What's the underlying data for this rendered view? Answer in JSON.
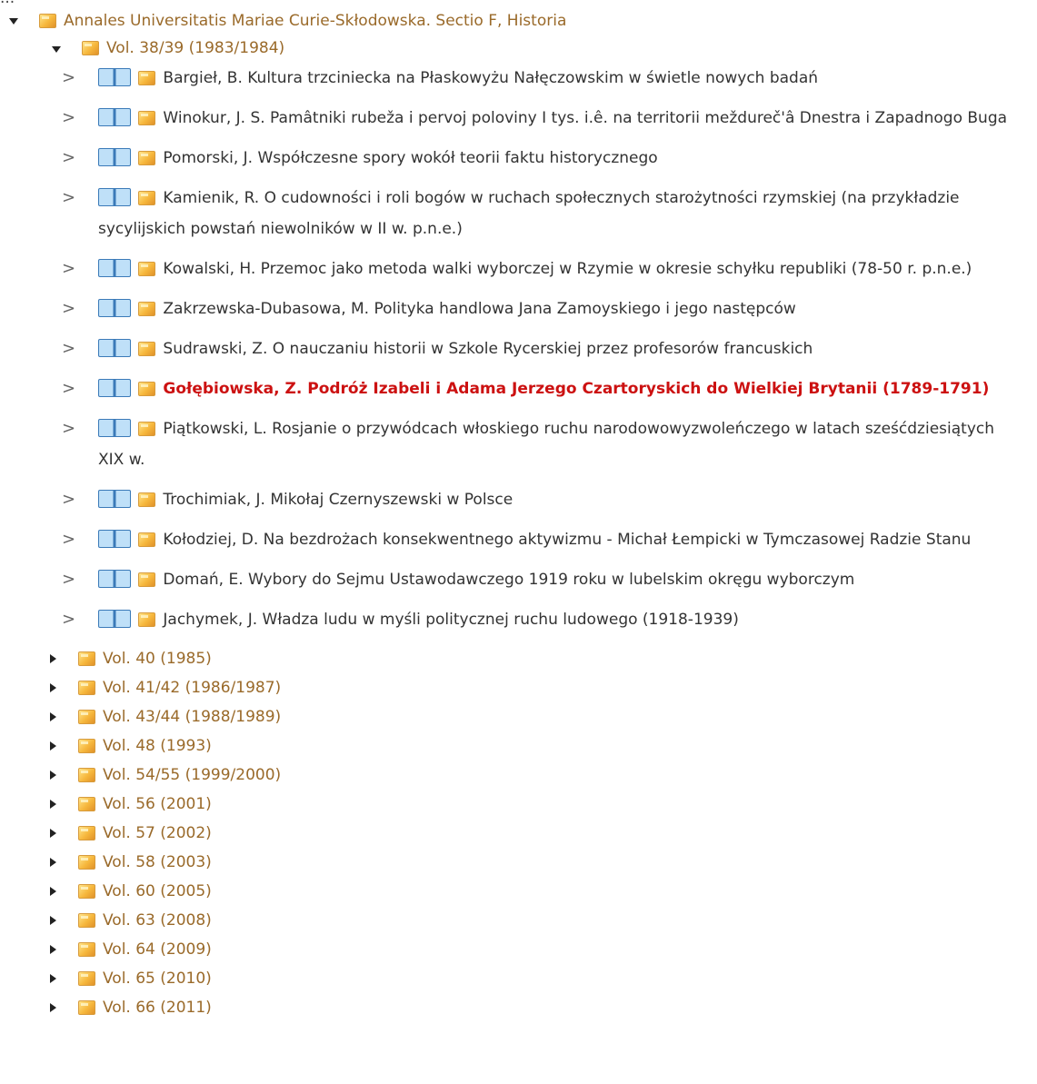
{
  "clipped_header": "...",
  "tree": {
    "root_label": "Annales Universitatis Mariae Curie-Skłodowska. Sectio F, Historia",
    "expanded_volume_label": "Vol. 38/39 (1983/1984)",
    "articles": [
      {
        "title": "Bargieł, B. Kultura trzciniecka na Płaskowyżu Nałęczowskim w świetle nowych badań",
        "highlighted": false
      },
      {
        "title": "Winokur, J. S. Pamâtniki rubeža i pervoj poloviny I tys. i.ê. na territorii meždureč'â Dnestra i Zapadnogo Buga",
        "highlighted": false
      },
      {
        "title": "Pomorski, J. Współczesne spory wokół teorii faktu historycznego",
        "highlighted": false
      },
      {
        "title": "Kamienik, R. O cudowności i roli bogów w ruchach społecznych starożytności rzymskiej (na przykładzie sycylijskich powstań niewolników w II w. p.n.e.)",
        "highlighted": false
      },
      {
        "title": "Kowalski, H. Przemoc jako metoda walki wyborczej w Rzymie w okresie schyłku republiki (78-50 r. p.n.e.)",
        "highlighted": false
      },
      {
        "title": "Zakrzewska-Dubasowa, M. Polityka handlowa Jana Zamoyskiego i jego następców",
        "highlighted": false
      },
      {
        "title": "Sudrawski, Z. O nauczaniu historii w Szkole Rycerskiej przez profesorów francuskich",
        "highlighted": false
      },
      {
        "title": "Gołębiowska, Z. Podróż Izabeli i Adama Jerzego Czartoryskich do Wielkiej Brytanii (1789-1791)",
        "highlighted": true
      },
      {
        "title": "Piątkowski, L. Rosjanie o przywódcach włoskiego ruchu narodowowyzwoleńczego w latach sześćdziesiątych XIX w.",
        "highlighted": false
      },
      {
        "title": "Trochimiak, J. Mikołaj Czernyszewski w Polsce",
        "highlighted": false
      },
      {
        "title": "Kołodziej, D. Na bezdrożach konsekwentnego aktywizmu - Michał Łempicki w Tymczasowej Radzie Stanu",
        "highlighted": false
      },
      {
        "title": "Domań, E. Wybory do Sejmu Ustawodawczego 1919 roku w lubelskim okręgu wyborczym",
        "highlighted": false
      },
      {
        "title": "Jachymek, J. Władza ludu w myśli politycznej ruchu ludowego (1918-1939)",
        "highlighted": false
      }
    ],
    "collapsed_volumes": [
      "Vol. 40 (1985)",
      "Vol. 41/42 (1986/1987)",
      "Vol. 43/44 (1988/1989)",
      "Vol. 48 (1993)",
      "Vol. 54/55 (1999/2000)",
      "Vol. 56 (2001)",
      "Vol. 57 (2002)",
      "Vol. 58 (2003)",
      "Vol. 60 (2005)",
      "Vol. 63 (2008)",
      "Vol. 64 (2009)",
      "Vol. 65 (2010)",
      "Vol. 66 (2011)"
    ]
  },
  "icons": {
    "expand": "triangle-down-icon",
    "collapse": "triangle-right-icon",
    "chevron": "chevron-right-icon",
    "book": "book-icon",
    "folder": "folder-icon"
  },
  "colors": {
    "link": "#9a6a2a",
    "highlight": "#cc1111",
    "text": "#333333"
  }
}
